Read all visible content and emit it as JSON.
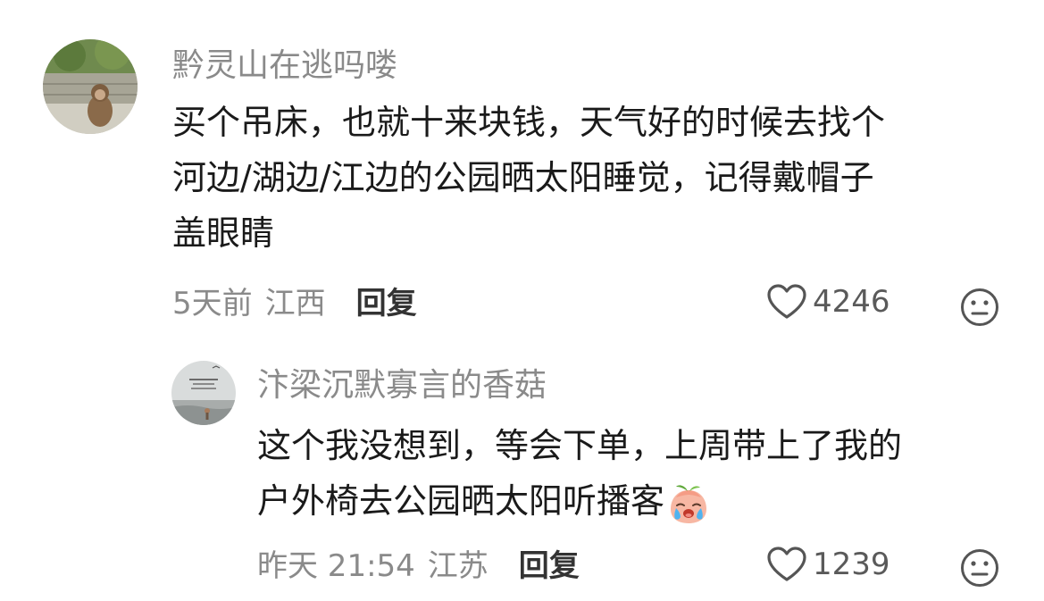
{
  "comments": [
    {
      "username": "黔灵山在逃吗喽",
      "lines": [
        "买个吊床，也就十来块钱，天气好的时候去找个",
        "河边/湖边/江边的公园晒太阳睡觉，记得戴帽子",
        "盖眼睛"
      ],
      "time": "5天前",
      "location": "江西",
      "reply_label": "回复",
      "likes": "4246",
      "avatar_icon": "monkey-photo-avatar"
    },
    {
      "username": "汴梁沉默寡言的香菇",
      "lines": [
        "这个我没想到，等会下单，上周带上了我的",
        "户外椅去公园晒太阳听播客"
      ],
      "emoji": "crying-peach-emoji",
      "time": "昨天 21:54",
      "location": "江苏",
      "reply_label": "回复",
      "likes": "1239",
      "avatar_icon": "sea-photo-avatar"
    }
  ],
  "icons": {
    "like": "heart-outline-icon",
    "dislike": "meh-face-icon"
  },
  "colors": {
    "username": "#8a8a8a",
    "text": "#1a1a1a",
    "meta": "#8a8a8a",
    "reply": "#333333"
  }
}
